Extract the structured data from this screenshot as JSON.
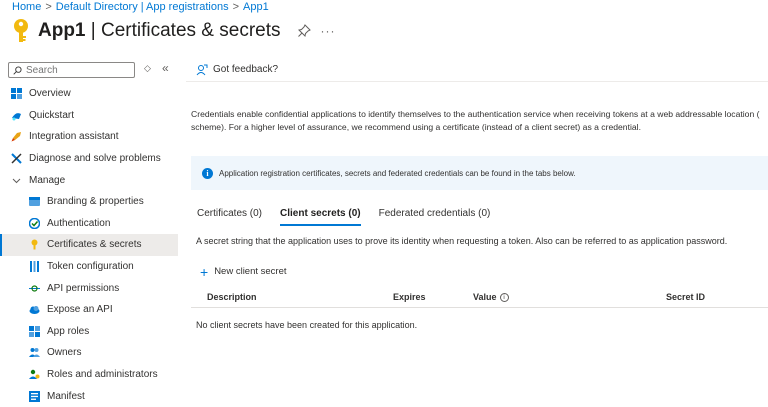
{
  "breadcrumb": {
    "items": [
      "Home",
      "Default Directory | App registrations",
      "App1"
    ],
    "separator": ">"
  },
  "header": {
    "app_name": "App1",
    "title_rest": " | Certificates & secrets",
    "more": "···",
    "key_icon": "key-icon",
    "pin_icon": "pin-icon"
  },
  "sidebar": {
    "search_placeholder": "Search",
    "collapse_symbol": "◇",
    "collapse_button": "«",
    "items": [
      {
        "label": "Overview",
        "icon": "overview-icon"
      },
      {
        "label": "Quickstart",
        "icon": "quickstart-icon"
      },
      {
        "label": "Integration assistant",
        "icon": "rocket-icon"
      },
      {
        "label": "Diagnose and solve problems",
        "icon": "wrench-icon"
      },
      {
        "label": "Manage",
        "icon": "chevron-down-icon"
      },
      {
        "label": "Branding & properties",
        "icon": "branding-icon"
      },
      {
        "label": "Authentication",
        "icon": "authentication-icon"
      },
      {
        "label": "Certificates & secrets",
        "icon": "key-icon"
      },
      {
        "label": "Token configuration",
        "icon": "token-icon"
      },
      {
        "label": "API permissions",
        "icon": "api-permissions-icon"
      },
      {
        "label": "Expose an API",
        "icon": "cloud-icon"
      },
      {
        "label": "App roles",
        "icon": "app-roles-icon"
      },
      {
        "label": "Owners",
        "icon": "owners-icon"
      },
      {
        "label": "Roles and administrators",
        "icon": "roles-icon"
      },
      {
        "label": "Manifest",
        "icon": "manifest-icon"
      }
    ]
  },
  "cmdbar": {
    "feedback_label": "Got feedback?"
  },
  "main": {
    "description_line1": "Credentials enable confidential applications to identify themselves to the authentication service when receiving tokens at a web addressable location (",
    "description_line2": "scheme). For a higher level of assurance, we recommend using a certificate (instead of a client secret) as a credential.",
    "info_icon_glyph": "i",
    "info_text": "Application registration certificates, secrets and federated credentials can be found in the tabs below.",
    "tabs": [
      {
        "label": "Certificates (0)",
        "active": false
      },
      {
        "label": "Client secrets (0)",
        "active": true
      },
      {
        "label": "Federated credentials (0)",
        "active": false
      }
    ],
    "secret_description": "A secret string that the application uses to prove its identity when requesting a token. Also can be referred to as application password.",
    "new_secret_plus": "+",
    "new_secret_label": "New client secret",
    "table_headers": {
      "description": "Description",
      "expires": "Expires",
      "value": "Value",
      "value_info": "i",
      "secret_id": "Secret ID"
    },
    "empty_message": "No client secrets have been created for this application."
  },
  "colors": {
    "accent": "#0078d4",
    "info_bg": "#eff6fc",
    "active_nav_bg": "#edebe9",
    "key_yellow": "#f2b90f"
  }
}
